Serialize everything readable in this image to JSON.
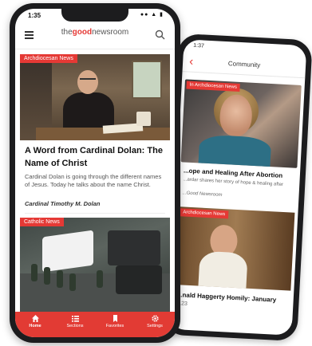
{
  "back_phone": {
    "status_time": "1:37",
    "header_title": "Community",
    "card1": {
      "category": "In Archdiocesan News",
      "headline": "...ope and Healing After Abortion",
      "excerpt": "...ardar shares her story of hope & healing after",
      "source": "...Good Newsroom"
    },
    "card2": {
      "category": "Archdiocesan News",
      "headline": "...nald Haggerty Homily: January",
      "subline": "...23"
    }
  },
  "front_phone": {
    "status_time": "1:35",
    "brand": {
      "part1": "the",
      "part2": "good",
      "part3": "newsroom"
    },
    "card1": {
      "category": "Archdiocesan News",
      "title": "A Word from Cardinal Dolan: The Name of Christ",
      "excerpt": "Cardinal Dolan is going through the different names of Jesus. Today he talks about the name Christ.",
      "author": "Cardinal Timothy M. Dolan"
    },
    "card2": {
      "category": "Catholic News"
    },
    "tabs": [
      {
        "label": "Home",
        "icon": "home-icon",
        "active": true
      },
      {
        "label": "Sections",
        "icon": "list-icon",
        "active": false
      },
      {
        "label": "Favorites",
        "icon": "bookmark-icon",
        "active": false
      },
      {
        "label": "Settings",
        "icon": "gear-icon",
        "active": false
      }
    ]
  },
  "colors": {
    "accent": "#e53935",
    "tabbar": "#e23b34",
    "phone_frame": "#1c1c1e"
  }
}
